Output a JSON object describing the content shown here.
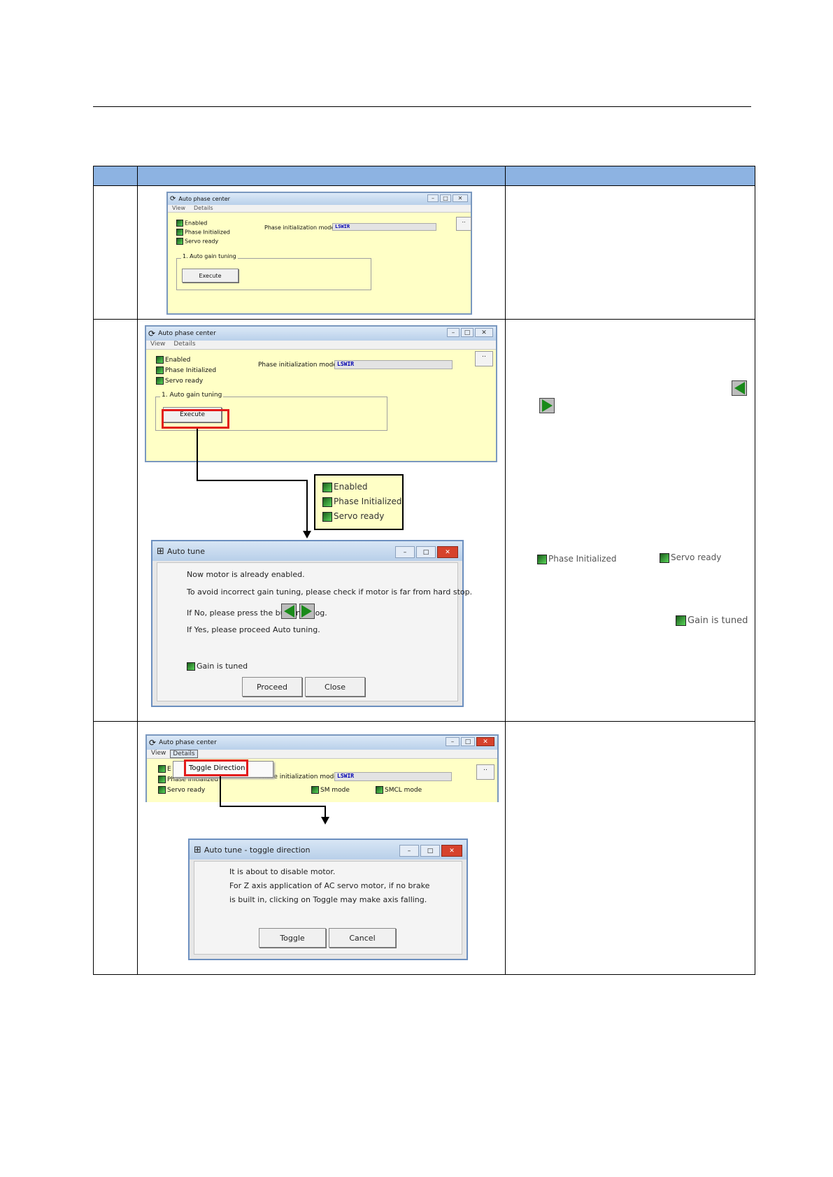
{
  "window1": {
    "title": "Auto phase center",
    "menu": [
      "View",
      "Details"
    ],
    "status": [
      "Enabled",
      "Phase Initialized",
      "Servo ready"
    ],
    "mode_label": "Phase initialization mode:",
    "mode_value": "LSWIR",
    "ellipsis": "..",
    "group_label": "1. Auto gain tuning",
    "execute_label": "Execute"
  },
  "window2": {
    "title": "Auto phase center",
    "menu": [
      "View",
      "Details"
    ],
    "status": [
      "Enabled",
      "Phase Initialized",
      "Servo ready"
    ],
    "mode_label": "Phase initialization mode:",
    "mode_value": "LSWIR",
    "ellipsis": "..",
    "group_label": "1. Auto gain tuning",
    "execute_label": "Execute"
  },
  "status_popup": [
    "Enabled",
    "Phase Initialized",
    "Servo ready"
  ],
  "autotune_dialog": {
    "title": "Auto tune",
    "line1": "Now motor is already enabled.",
    "line2": "To avoid incorrect gain tuning, please check if motor is far from hard stop.",
    "line3": "If No, please press the button of jog.",
    "line4": "If Yes, please proceed Auto tuning.",
    "gain_label": "Gain is tuned",
    "proceed_label": "Proceed",
    "close_label": "Close"
  },
  "row2_notes": {
    "phase_initialized": "Phase Initialized",
    "servo_ready": "Servo ready",
    "gain_tuned": "Gain is tuned"
  },
  "window3": {
    "title": "Auto phase center",
    "menu": [
      "View",
      "Details"
    ],
    "menu_item": "Toggle Direction",
    "status": [
      "E",
      "Phase Initialized",
      "Servo ready"
    ],
    "mode_label": "Phase initialization mode:",
    "mode_value": "LSWIR",
    "ellipsis": "..",
    "sm_mode": "SM mode",
    "smcl_mode": "SMCL mode"
  },
  "toggle_dialog": {
    "title": "Auto tune - toggle direction",
    "line1": "It is about to disable motor.",
    "line2": "For Z axis application of AC servo motor, if no brake",
    "line3": "is built in, clicking on Toggle may make axis falling.",
    "toggle_label": "Toggle",
    "cancel_label": "Cancel"
  }
}
